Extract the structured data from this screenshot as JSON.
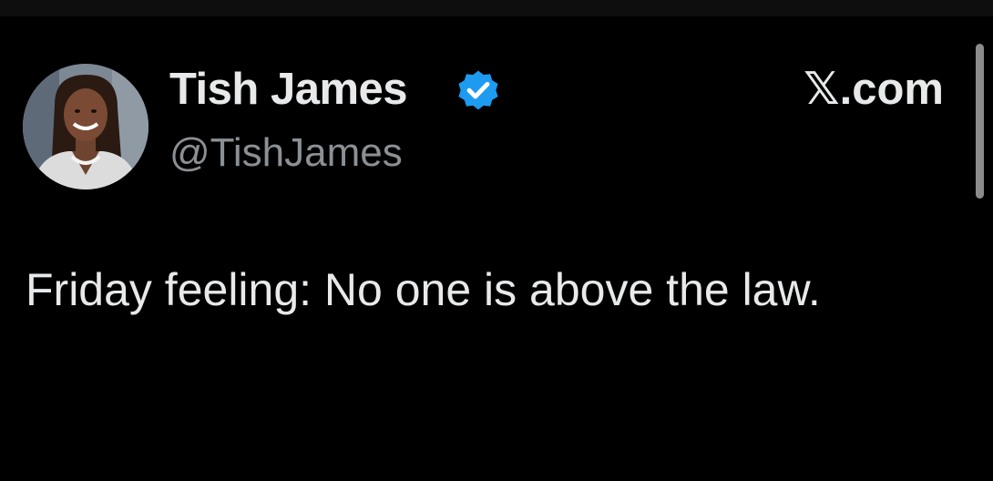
{
  "tweet": {
    "author": {
      "display_name": "Tish James",
      "handle": "@TishJames",
      "verified": true,
      "avatar": "profile-photo"
    },
    "source": "𝕏.com",
    "text": "Friday feeling: No one is above the law."
  },
  "colors": {
    "background": "#000000",
    "text_primary": "#e7e9ea",
    "text_secondary": "#8b9095",
    "verified_blue": "#1d9bf0"
  }
}
